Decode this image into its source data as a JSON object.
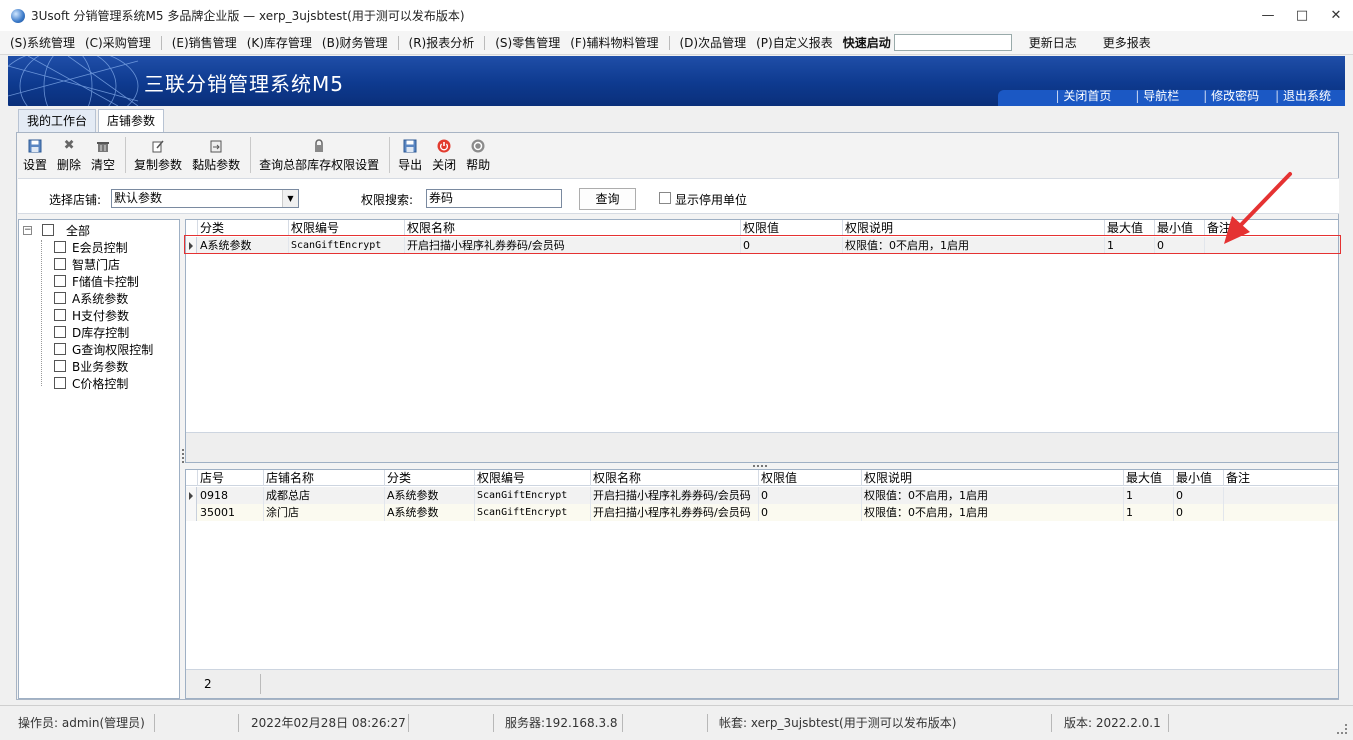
{
  "window": {
    "title": "3Usoft 分销管理系统M5 多品牌企业版 — xerp_3ujsbtest(用于测可以发布版本)",
    "controls": {
      "minimize": "—",
      "maximize": "□",
      "close": "✕"
    }
  },
  "menu": {
    "items": [
      "(S)系统管理",
      "(C)采购管理",
      "(E)销售管理",
      "(K)库存管理",
      "(B)财务管理",
      "(R)报表分析",
      "(S)零售管理",
      "(F)辅料物料管理",
      "(D)次品管理",
      "(P)自定义报表"
    ],
    "quick_launch_label": "快速启动",
    "quick_launch_value": "",
    "update_log": "更新日志",
    "more_reports": "更多报表"
  },
  "banner": {
    "title": "三联分销管理系统M5",
    "links": [
      "关闭首页",
      "导航栏",
      "修改密码",
      "退出系统"
    ]
  },
  "tabs": [
    "我的工作台",
    "店铺参数"
  ],
  "toolbar": [
    {
      "label": "设置",
      "icon": "save-icon"
    },
    {
      "label": "删除",
      "icon": "delete-icon"
    },
    {
      "label": "清空",
      "icon": "trash-icon"
    },
    {
      "label": "复制参数",
      "icon": "copy-icon"
    },
    {
      "label": "黏贴参数",
      "icon": "paste-icon"
    },
    {
      "label": "查询总部库存权限设置",
      "icon": "lock-icon"
    },
    {
      "label": "导出",
      "icon": "export-icon"
    },
    {
      "label": "关闭",
      "icon": "close-power-icon"
    },
    {
      "label": "帮助",
      "icon": "help-icon"
    }
  ],
  "filter": {
    "store_label": "选择店铺:",
    "store_value": "默认参数",
    "search_label": "权限搜索:",
    "search_value": "券码",
    "query_button": "查询",
    "show_disabled_label": "显示停用单位"
  },
  "tree": {
    "root": "全部",
    "items": [
      "E会员控制",
      "智慧门店",
      "F储值卡控制",
      "A系统参数",
      "H支付参数",
      "D库存控制",
      "G查询权限控制",
      "B业务参数",
      "C价格控制"
    ]
  },
  "top_grid": {
    "columns": [
      "分类",
      "权限编号",
      "权限名称",
      "权限值",
      "权限说明",
      "最大值",
      "最小值",
      "备注"
    ],
    "rows": [
      [
        "A系统参数",
        "ScanGiftEncrypt",
        "开启扫描小程序礼券券码/会员码",
        "0",
        "权限值：0不启用，1启用",
        "1",
        "0",
        ""
      ]
    ]
  },
  "bottom_grid": {
    "columns": [
      "店号",
      "店铺名称",
      "分类",
      "权限编号",
      "权限名称",
      "权限值",
      "权限说明",
      "最大值",
      "最小值",
      "备注"
    ],
    "rows": [
      [
        "0918",
        "成都总店",
        "A系统参数",
        "ScanGiftEncrypt",
        "开启扫描小程序礼券券码/会员码",
        "0",
        "权限值：0不启用，1启用",
        "1",
        "0",
        ""
      ],
      [
        "35001",
        "涂门店",
        "A系统参数",
        "ScanGiftEncrypt",
        "开启扫描小程序礼券券码/会员码",
        "0",
        "权限值：0不启用，1启用",
        "1",
        "0",
        ""
      ]
    ],
    "record_count": "2"
  },
  "status": {
    "operator": "操作员: admin(管理员)",
    "datetime": "2022年02月28日 08:26:27",
    "server": "服务器:192.168.3.8",
    "account": "帐套: xerp_3ujsbtest(用于测可以发布版本)",
    "version": "版本: 2022.2.0.1"
  },
  "colors": {
    "banner": "#0e3a8f",
    "annotation_red": "#e53232"
  }
}
